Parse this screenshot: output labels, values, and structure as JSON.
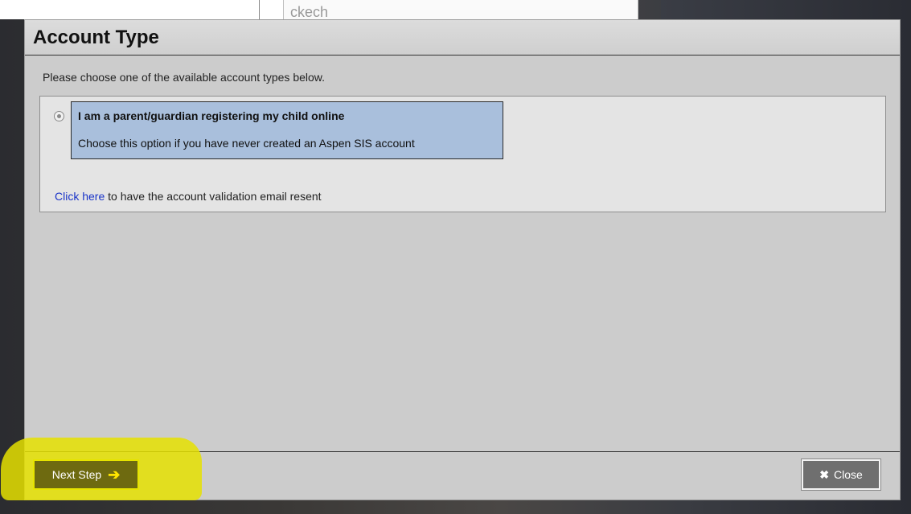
{
  "background": {
    "heading_fragment": "",
    "field_text": "ckech"
  },
  "dialog": {
    "title": "Account Type",
    "intro": "Please choose one of the available account types below.",
    "option": {
      "title": "I am a parent/guardian registering my child online",
      "description": "Choose this option if you have never created an Aspen SIS account",
      "selected": true
    },
    "resend": {
      "link_text": "Click here",
      "rest_text": " to have the account validation email resent"
    },
    "footer": {
      "next_label": "Next Step",
      "next_icon": "arrow-right-icon",
      "close_label": "Close",
      "close_icon": "x-icon"
    }
  },
  "colors": {
    "highlight": "#e5e100",
    "option_bg": "#a9bfdc",
    "link": "#1a34c8"
  }
}
